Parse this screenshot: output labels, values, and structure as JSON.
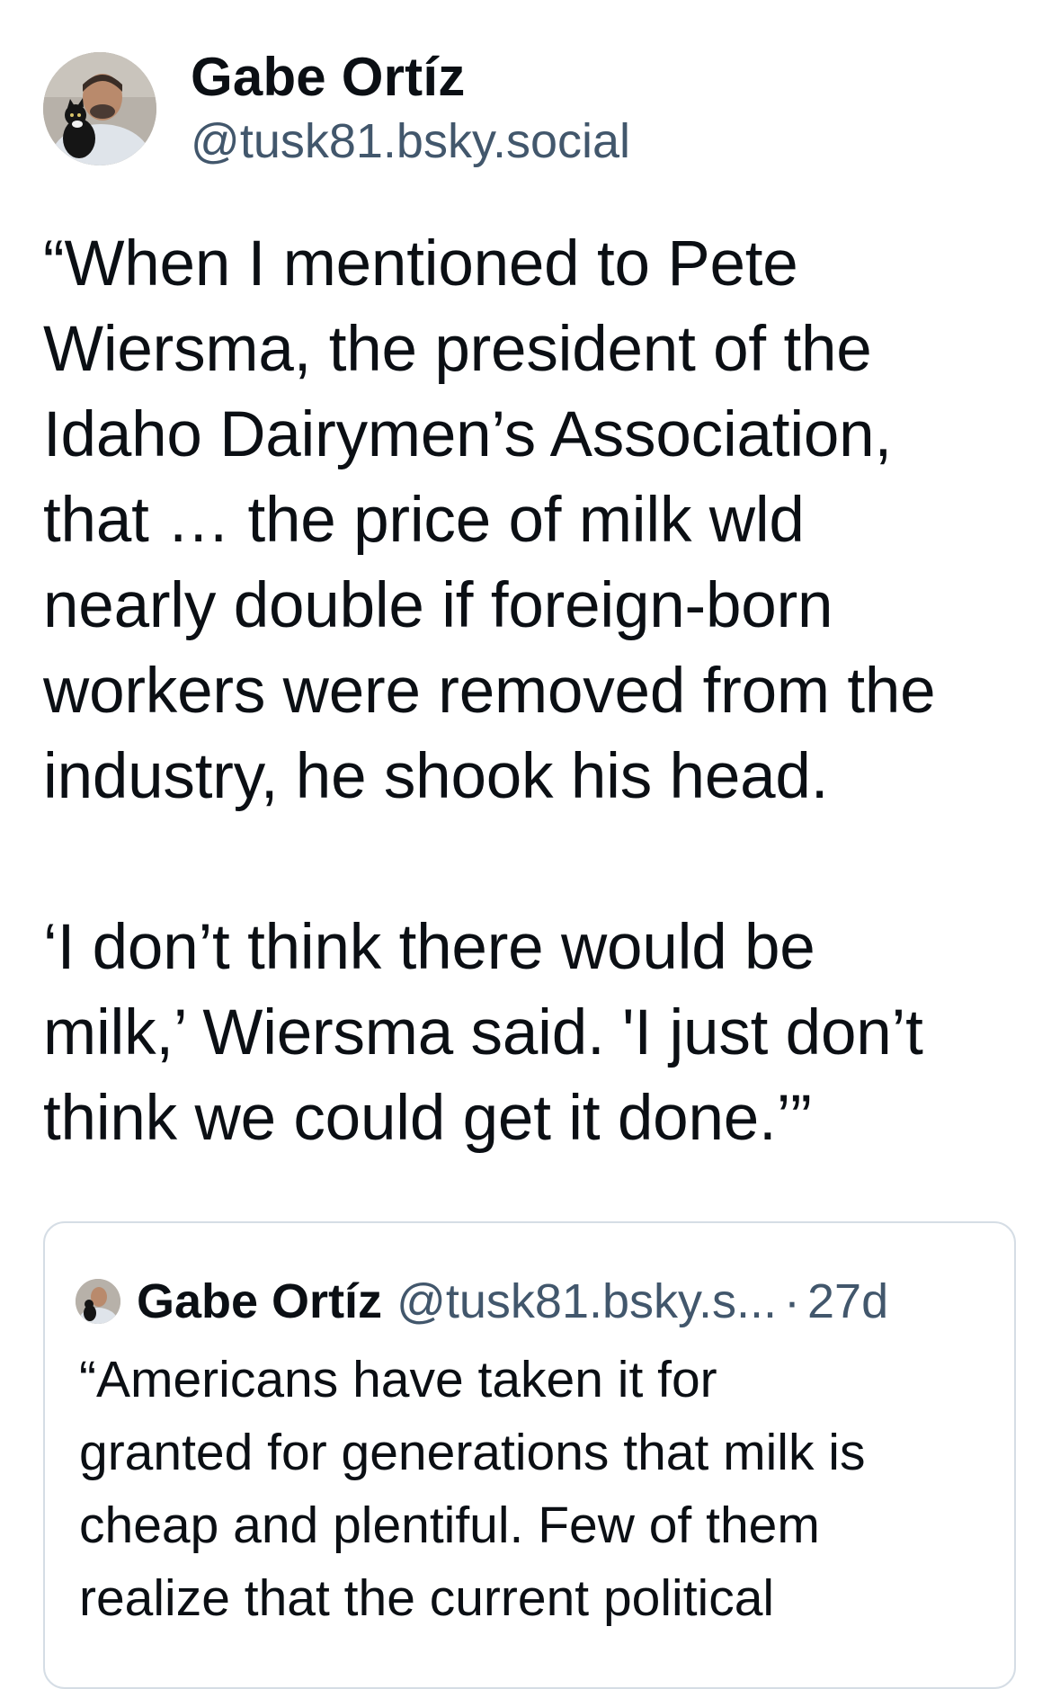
{
  "post": {
    "author": {
      "name": "Gabe Ortíz",
      "handle": "@tusk81.bsky.social",
      "avatar_icon": "profile-photo-man-with-black-cat"
    },
    "text": "“When I mentioned to Pete\nWiersma, the president of the\nIdaho Dairymen’s Association,\nthat … the price of milk wld\nnearly double if foreign-born\nworkers were removed from the\nindustry, he shook his head.\n\n‘I don’t think there would be\nmilk,’ Wiersma said. 'I just don’t\nthink we could get it done.’”",
    "quoted_post": {
      "author_name": "Gabe Ortíz",
      "handle": "@tusk81.bsky.s...",
      "separator": "·",
      "age": "27d",
      "text": "“Americans have taken it for\ngranted for generations that milk is\ncheap and plentiful. Few of them\nrealize that the current political"
    }
  }
}
